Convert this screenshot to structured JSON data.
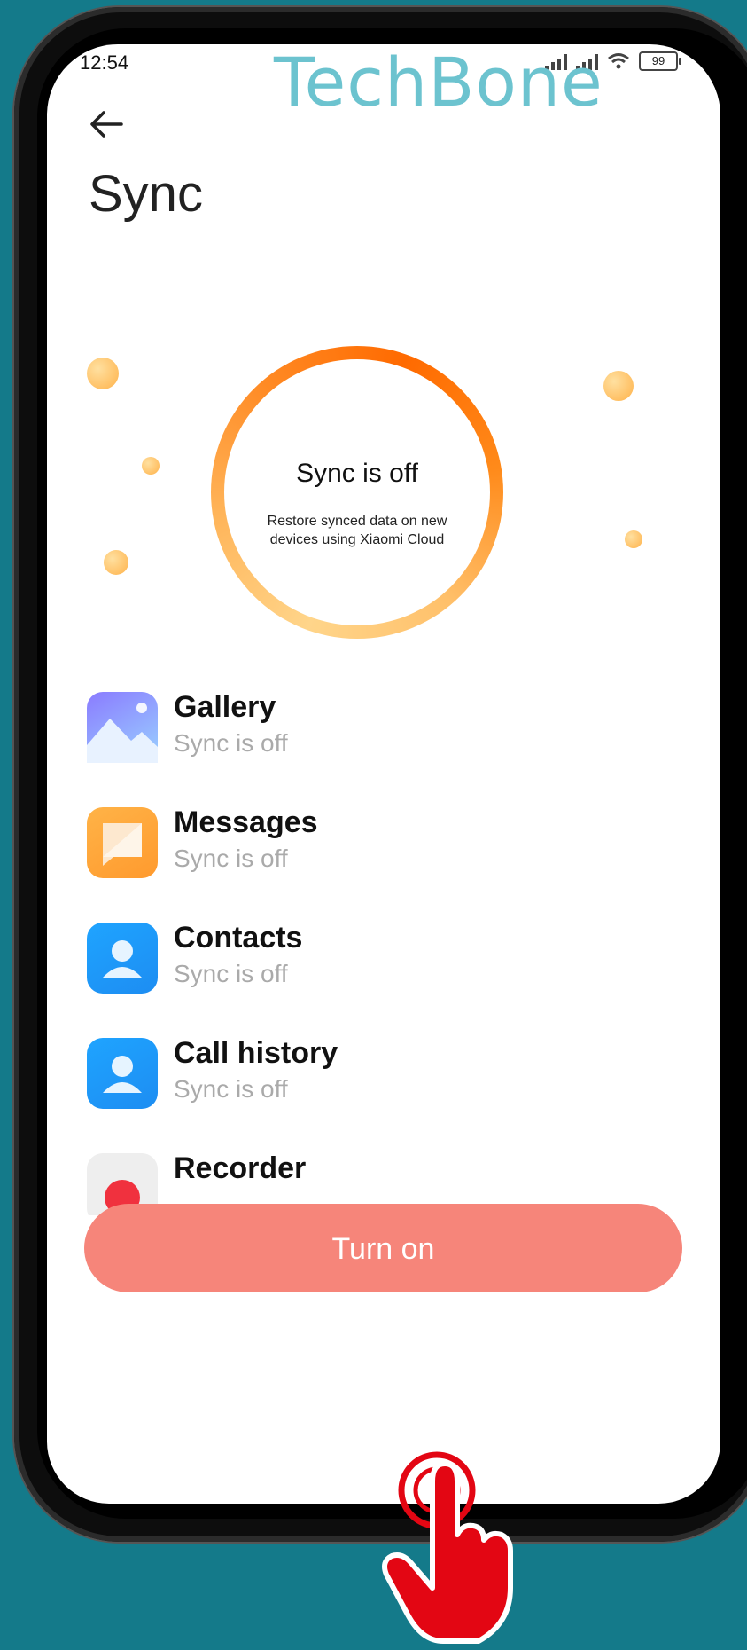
{
  "watermark": "TechBone",
  "status_bar": {
    "time": "12:54",
    "battery": "99"
  },
  "page": {
    "title": "Sync"
  },
  "summary": {
    "title": "Sync is off",
    "description": "Restore synced data on new devices using Xiaomi Cloud"
  },
  "apps": [
    {
      "name": "Gallery",
      "status": "Sync is off",
      "icon": "gallery-icon"
    },
    {
      "name": "Messages",
      "status": "Sync is off",
      "icon": "messages-icon"
    },
    {
      "name": "Contacts",
      "status": "Sync is off",
      "icon": "contacts-icon"
    },
    {
      "name": "Call history",
      "status": "Sync is off",
      "icon": "call-history-icon"
    },
    {
      "name": "Recorder",
      "status": "",
      "icon": "recorder-icon"
    }
  ],
  "primary_button": {
    "label": "Turn on"
  },
  "colors": {
    "accent": "#ff7a14",
    "button": "#f6857a",
    "background": "#147a8a"
  }
}
